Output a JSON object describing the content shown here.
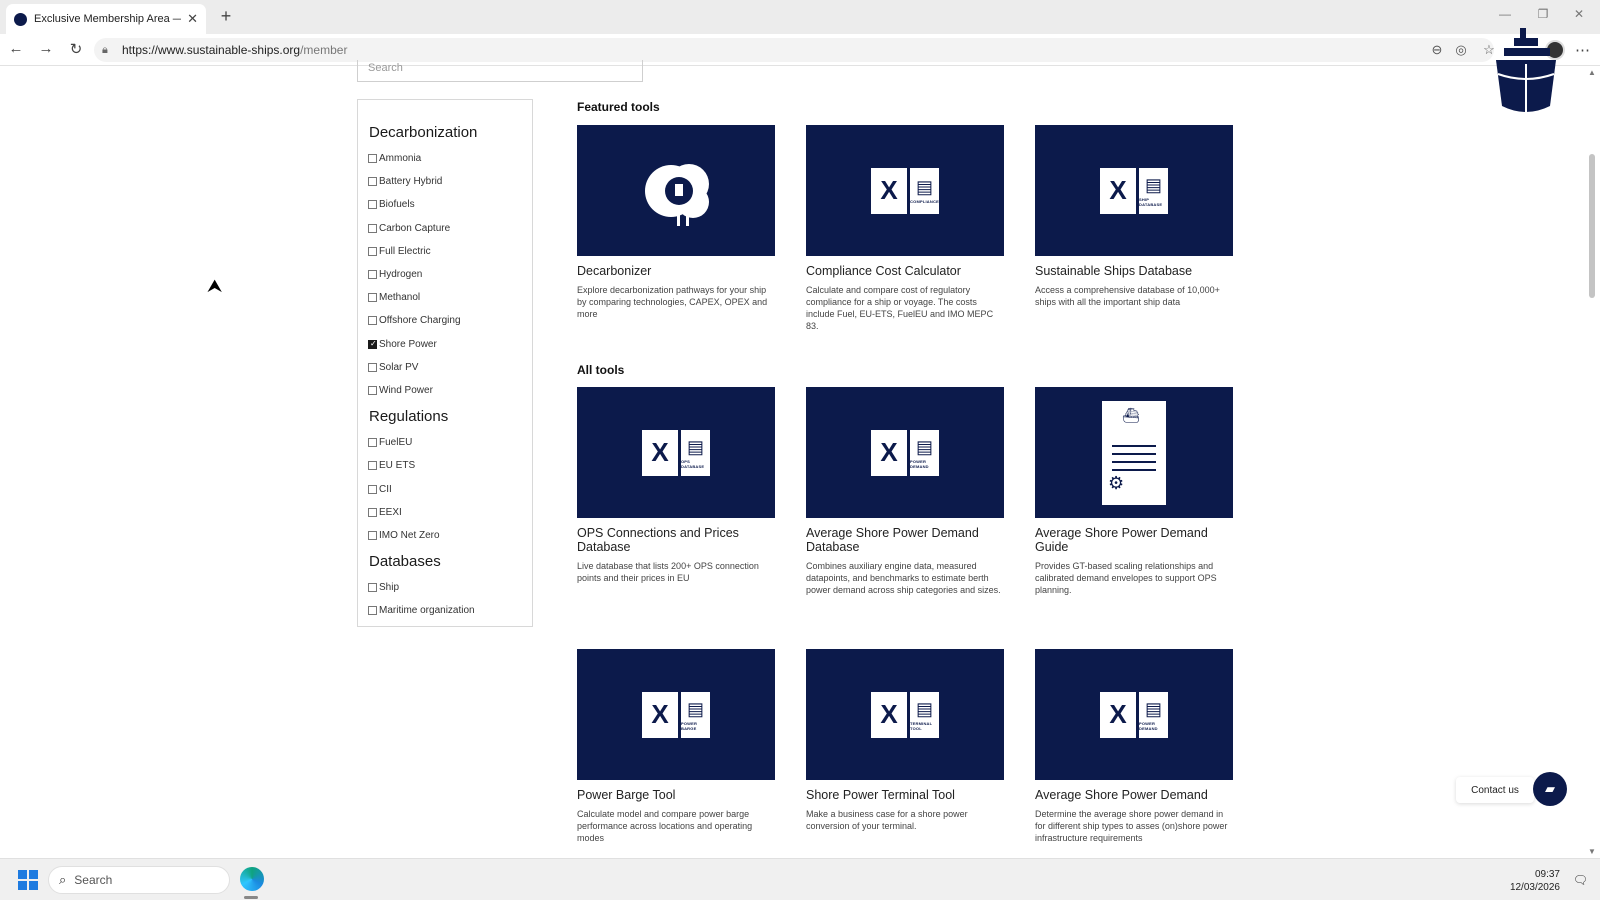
{
  "browser": {
    "tab_title": "Exclusive Membership Area — Sus",
    "url_host": "https://www.sustainable-ships.org",
    "url_path": "/member"
  },
  "search": {
    "placeholder": "Search"
  },
  "filters": {
    "groups": [
      {
        "heading": "Decarbonization",
        "items": [
          {
            "label": "Ammonia",
            "checked": false
          },
          {
            "label": "Battery Hybrid",
            "checked": false
          },
          {
            "label": "Biofuels",
            "checked": false
          },
          {
            "label": "Carbon Capture",
            "checked": false
          },
          {
            "label": "Full Electric",
            "checked": false
          },
          {
            "label": "Hydrogen",
            "checked": false
          },
          {
            "label": "Methanol",
            "checked": false
          },
          {
            "label": "Offshore Charging",
            "checked": false
          },
          {
            "label": "Shore Power",
            "checked": true
          },
          {
            "label": "Solar PV",
            "checked": false
          },
          {
            "label": "Wind Power",
            "checked": false
          }
        ]
      },
      {
        "heading": "Regulations",
        "items": [
          {
            "label": "FuelEU",
            "checked": false
          },
          {
            "label": "EU ETS",
            "checked": false
          },
          {
            "label": "CII",
            "checked": false
          },
          {
            "label": "EEXI",
            "checked": false
          },
          {
            "label": "IMO Net Zero",
            "checked": false
          }
        ]
      },
      {
        "heading": "Databases",
        "items": [
          {
            "label": "Ship",
            "checked": false
          },
          {
            "label": "Maritime organization",
            "checked": false
          }
        ]
      }
    ]
  },
  "featured": {
    "title": "Featured tools",
    "cards": [
      {
        "title": "Decarbonizer",
        "desc": "Explore decarbonization pathways for your ship by comparing technologies, CAPEX, OPEX and more",
        "icon": "decarbonizer-gear-cloud-icon",
        "caption": ""
      },
      {
        "title": "Compliance Cost Calculator",
        "desc": "Calculate and compare cost of regulatory compliance for a ship or voyage. The costs include Fuel, EU-ETS, FuelEU and IMO MEPC 83.",
        "icon": "excel-compliance-icon",
        "caption": "COMPLIANCE"
      },
      {
        "title": "Sustainable Ships Database",
        "desc": "Access a comprehensive database of 10,000+ ships with all the important ship data",
        "icon": "excel-ship-database-icon",
        "caption": "SHIP DATABASE"
      }
    ]
  },
  "all_tools": {
    "title": "All tools",
    "cards": [
      {
        "title": "OPS Connections and Prices Database",
        "desc": "Live database that lists 200+ OPS connection points and their prices in EU",
        "icon": "excel-ops-database-icon",
        "caption": "OPS DATABASE"
      },
      {
        "title": "Average Shore Power Demand Database",
        "desc": "Combines auxiliary engine data, measured datapoints, and benchmarks to estimate berth power demand across ship categories and sizes.",
        "icon": "excel-power-demand-icon",
        "caption": "POWER DEMAND"
      },
      {
        "title": "Average Shore Power Demand Guide",
        "desc": "Provides GT-based scaling relationships and calibrated demand envelopes to support OPS planning.",
        "icon": "guide-document-icon",
        "caption": ""
      },
      {
        "title": "Power Barge Tool",
        "desc": "Calculate model and compare power barge performance across locations and operating modes",
        "icon": "excel-power-barge-icon",
        "caption": "POWER BARGE"
      },
      {
        "title": "Shore Power Terminal Tool",
        "desc": "Make a business case for a shore power conversion of your terminal.",
        "icon": "excel-terminal-tool-icon",
        "caption": "TERMINAL TOOL"
      },
      {
        "title": "Average Shore Power Demand",
        "desc": "Determine the average shore power demand in for different ship types to asses (on)shore power infrastructure requirements",
        "icon": "excel-power-demand-icon",
        "caption": "POWER DEMAND"
      }
    ]
  },
  "contact": {
    "label": "Contact us"
  },
  "taskbar": {
    "search_label": "Search",
    "time": "09:37",
    "date": "12/03/2026"
  },
  "colors": {
    "brand_navy": "#0c1a4b"
  }
}
